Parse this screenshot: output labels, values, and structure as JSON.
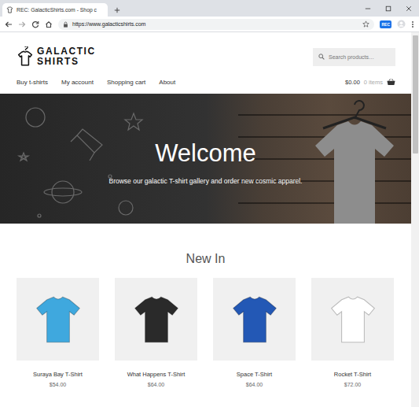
{
  "window": {
    "title": "REC: GalacticShirts.com - Shop c"
  },
  "browser": {
    "url": "https://www.galacticshirts.com",
    "extension_badge": "REC"
  },
  "site": {
    "logo": [
      "GALACTIC",
      "SHIRTS"
    ],
    "search": {
      "placeholder": "Search products…"
    },
    "nav": [
      {
        "label": "Buy t-shirts"
      },
      {
        "label": "My account"
      },
      {
        "label": "Shopping cart"
      },
      {
        "label": "About"
      }
    ],
    "cart": {
      "total": "$0.00",
      "items": "0 items"
    }
  },
  "hero": {
    "title": "Welcome",
    "subtitle": "Browse our galactic T-shirt gallery and order new cosmic apparel."
  },
  "section_title": "New In",
  "products": [
    {
      "name": "Suraya Bay T-Shirt",
      "price": "$54.00",
      "color": "#3fa8de"
    },
    {
      "name": "What Happens T-Shirt",
      "price": "$64.00",
      "color": "#2a2a2a"
    },
    {
      "name": "Space T-Shirt",
      "price": "$64.00",
      "color": "#2358b5"
    },
    {
      "name": "Rocket T-Shirt",
      "price": "$72.00",
      "color": "#ffffff"
    }
  ]
}
